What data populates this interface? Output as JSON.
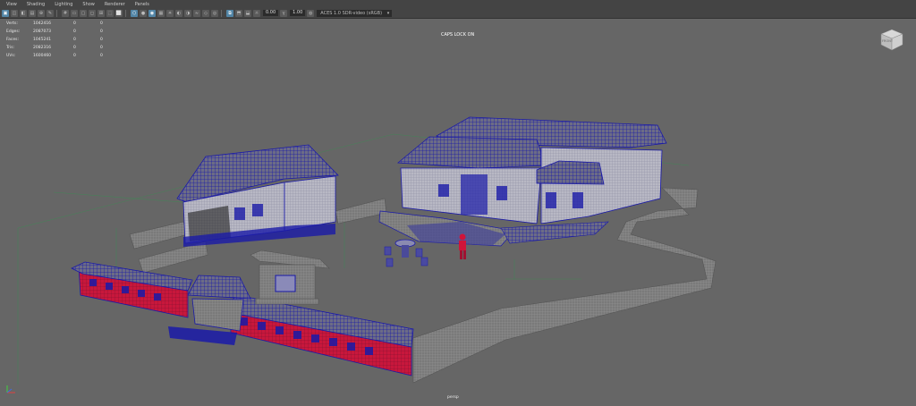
{
  "menu": [
    "View",
    "Shading",
    "Lighting",
    "Show",
    "Renderer",
    "Panels"
  ],
  "toolbar": {
    "field_a": "0.00",
    "field_b": "1.00",
    "colorspace": "ACES 1.0 SDR-video (sRGB)"
  },
  "hud": {
    "rows": [
      {
        "label": "Verts:",
        "v1": "1042416",
        "v2": "0",
        "v3": "0"
      },
      {
        "label": "Edges:",
        "v1": "2087073",
        "v2": "0",
        "v3": "0"
      },
      {
        "label": "Faces:",
        "v1": "1045241",
        "v2": "0",
        "v3": "0"
      },
      {
        "label": "Tris:",
        "v1": "2082316",
        "v2": "0",
        "v3": "0"
      },
      {
        "label": "UVs:",
        "v1": "1600460",
        "v2": "0",
        "v3": "0"
      }
    ]
  },
  "viewport": {
    "caps_lock": "CAPS LOCK ON",
    "camera": "persp",
    "viewcube_face": "FRONT"
  },
  "colors": {
    "background": "#666666",
    "wire_blue": "#1a1aa8",
    "wire_gray": "#8a8a8a",
    "wall_red": "#c8173c",
    "accent": "#5285a6"
  }
}
